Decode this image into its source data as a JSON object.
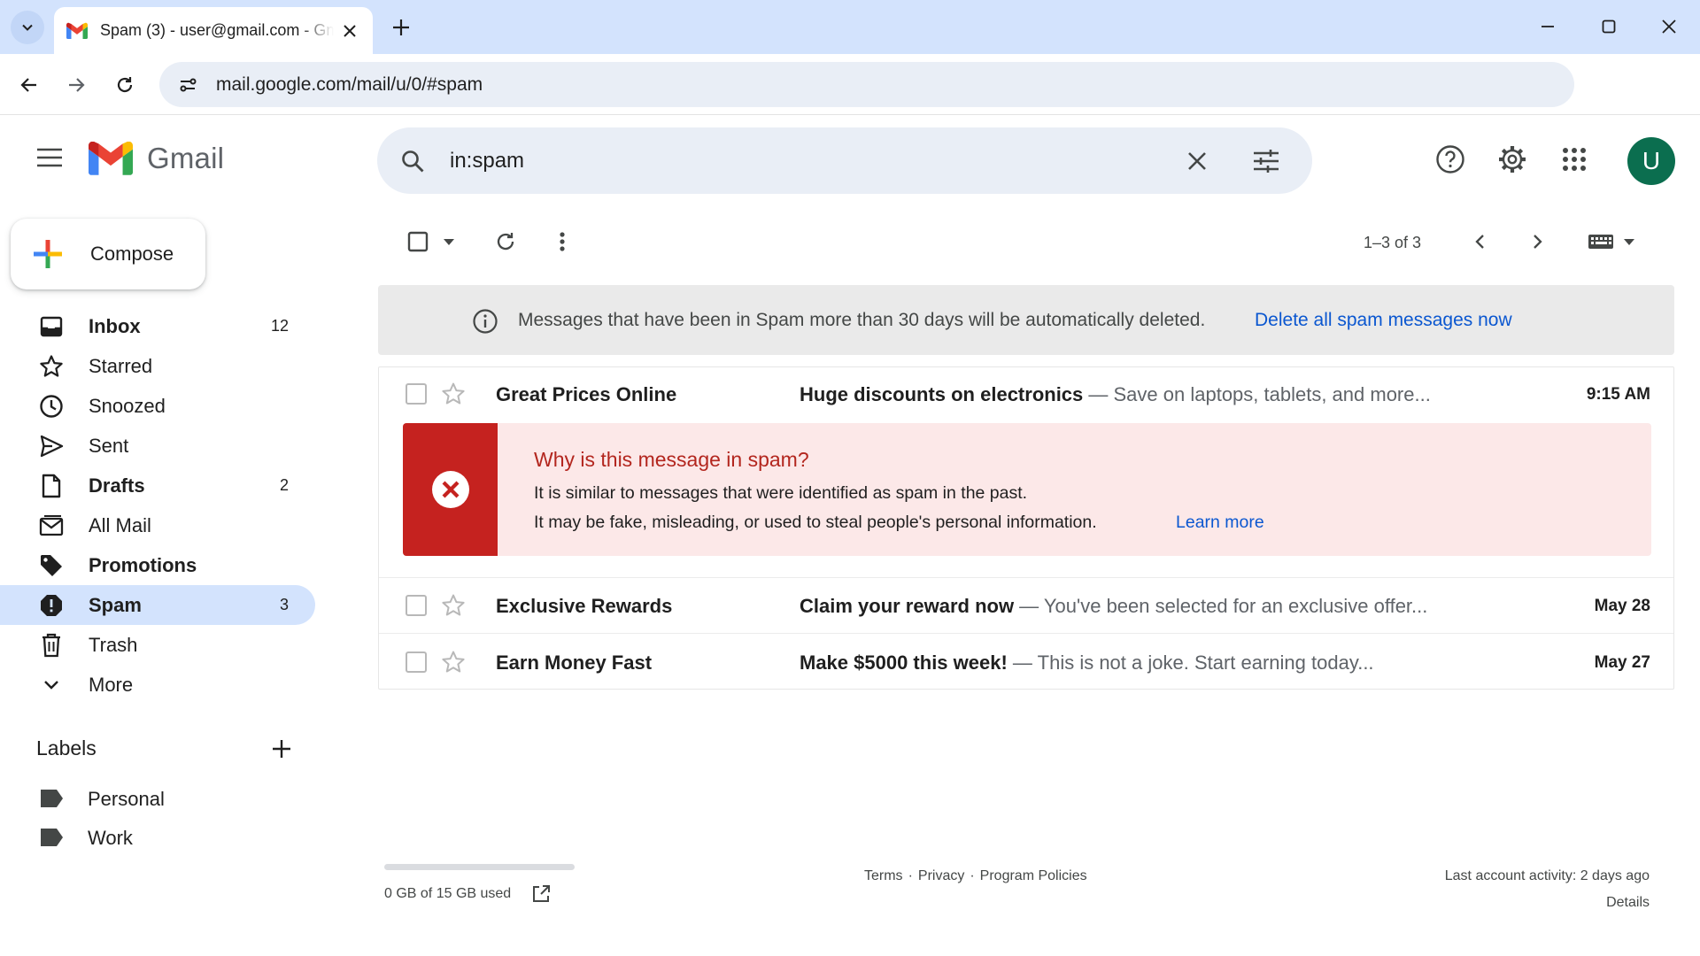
{
  "browser": {
    "tab_title": "Spam (3) - user@gmail.com - Gmail",
    "url": "mail.google.com/mail/u/0/#spam"
  },
  "app": {
    "name": "Gmail",
    "account_initial": "U"
  },
  "search": {
    "value": "in:spam"
  },
  "compose": {
    "label": "Compose"
  },
  "sidebar": {
    "items": [
      {
        "label": "Inbox",
        "count": "12",
        "icon": "inbox-icon",
        "bold": true
      },
      {
        "label": "Starred",
        "count": "",
        "icon": "star-icon",
        "bold": false
      },
      {
        "label": "Snoozed",
        "count": "",
        "icon": "clock-icon",
        "bold": false
      },
      {
        "label": "Sent",
        "count": "",
        "icon": "send-icon",
        "bold": false
      },
      {
        "label": "Drafts",
        "count": "2",
        "icon": "draft-icon",
        "bold": true
      },
      {
        "label": "All Mail",
        "count": "",
        "icon": "all-mail-icon",
        "bold": false
      },
      {
        "label": "Promotions",
        "count": "",
        "icon": "tag-icon",
        "bold": true
      },
      {
        "label": "Spam",
        "count": "3",
        "icon": "spam-icon",
        "bold": true,
        "active": true
      },
      {
        "label": "Trash",
        "count": "",
        "icon": "trash-icon",
        "bold": false
      },
      {
        "label": "More",
        "count": "",
        "icon": "chevron-down-icon",
        "bold": false
      }
    ],
    "labels_title": "Labels",
    "labels": [
      {
        "name": "Personal"
      },
      {
        "name": "Work"
      }
    ]
  },
  "toolbar": {
    "page_count": "1–3 of 3"
  },
  "banner": {
    "text": "Messages that have been in Spam more than 30 days will be automatically deleted.",
    "link": "Delete all spam messages now"
  },
  "messages": [
    {
      "sender": "Great Prices Online",
      "subject": "Huge discounts on electronics",
      "snippet": " — Save on laptops, tablets, and more...",
      "date": "9:15 AM"
    },
    {
      "sender": "Exclusive Rewards",
      "subject": "Claim your reward now",
      "snippet": " — You've been selected for an exclusive offer...",
      "date": "May 28"
    },
    {
      "sender": "Earn Money Fast",
      "subject": "Make $5000 this week!",
      "snippet": " — This is not a joke. Start earning today...",
      "date": "May 27"
    }
  ],
  "spam_warning": {
    "title": "Why is this message in spam?",
    "line1": "It is similar to messages that were identified as spam in the past.",
    "line2": "It may be fake, misleading, or used to steal people's personal information.",
    "link": "Learn more"
  },
  "footer": {
    "storage": "0 GB of 15 GB used",
    "storage_fraction": 0.0,
    "links": [
      "Terms",
      "Privacy",
      "Program Policies"
    ],
    "separator": "·",
    "activity": "Last account activity: 2 days ago",
    "details": "Details"
  },
  "colors": {
    "accent_blue": "#0b57d0",
    "active_nav": "#d3e3fd",
    "spam_red": "#c5221f",
    "avatar": "#0b6e4f"
  }
}
